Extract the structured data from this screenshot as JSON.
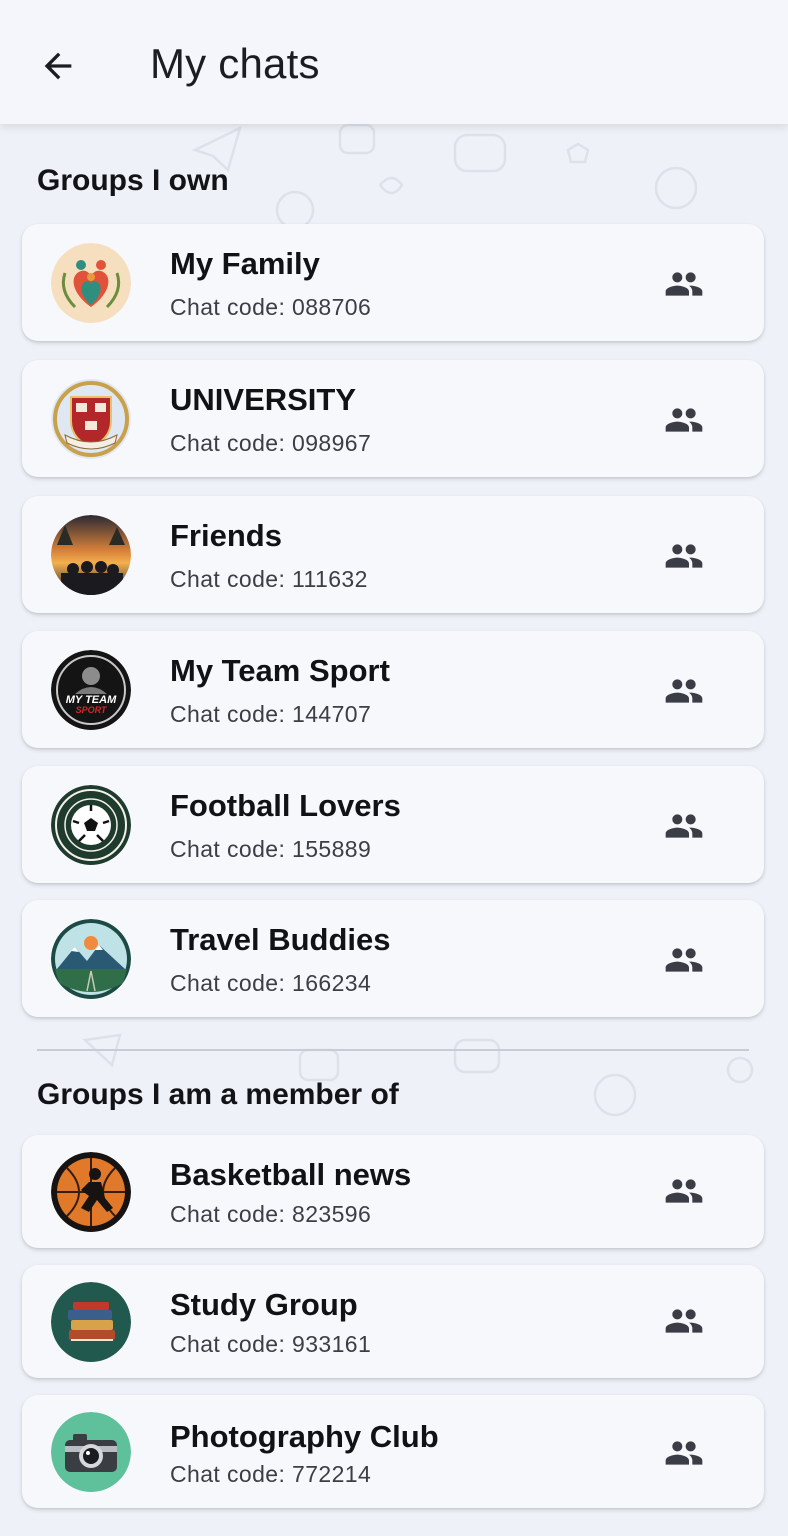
{
  "appbar": {
    "title": "My chats",
    "back_icon": "arrow-back-icon"
  },
  "sections": [
    {
      "title": "Groups I own",
      "chats": [
        {
          "name": "My Family",
          "code": "Chat code: 088706",
          "avatar": "family-heart-avatar"
        },
        {
          "name": "UNIVERSITY",
          "code": "Chat code: 098967",
          "avatar": "university-crest-avatar"
        },
        {
          "name": "Friends",
          "code": "Chat code: 111632",
          "avatar": "friends-sunset-avatar"
        },
        {
          "name": "My Team Sport",
          "code": "Chat code: 144707",
          "avatar": "team-sport-badge-avatar"
        },
        {
          "name": "Football Lovers",
          "code": "Chat code: 155889",
          "avatar": "football-badge-avatar"
        },
        {
          "name": "Travel Buddies",
          "code": "Chat code: 166234",
          "avatar": "mountain-travel-avatar"
        }
      ]
    },
    {
      "title": "Groups I am a member of",
      "chats": [
        {
          "name": "Basketball news",
          "code": "Chat code: 823596",
          "avatar": "basketball-player-avatar"
        },
        {
          "name": "Study Group",
          "code": "Chat code: 933161",
          "avatar": "books-avatar"
        },
        {
          "name": "Photography Club",
          "code": "Chat code: 772214",
          "avatar": "camera-avatar"
        }
      ]
    }
  ],
  "avatar_text": {
    "team_sport_line1": "MY TEAM",
    "team_sport_line2": "SPORT"
  },
  "colors": {
    "background": "#eef1f8",
    "appbar": "#f5f6fb",
    "card": "#f7f8fc",
    "icon": "#3a3d45"
  }
}
